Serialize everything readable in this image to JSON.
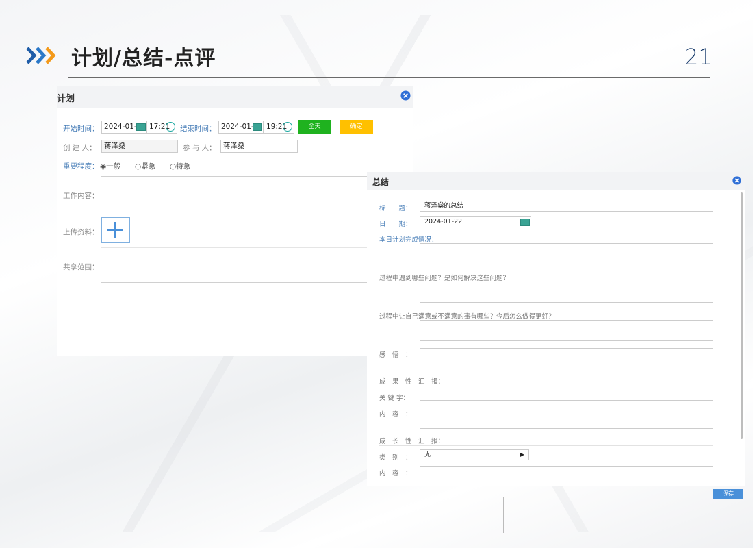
{
  "slide": {
    "title": "计划/总结-点评",
    "page_number": "21"
  },
  "plan": {
    "title": "计划",
    "start_label": "开始时间：",
    "start_date": "2024-01-22",
    "start_time": "17:21",
    "end_label": "结束时间：",
    "end_date": "2024-01-22",
    "end_time": "19:21",
    "allday_button": "全天",
    "confirm_button": "确定",
    "creator_label": "创 建 人：",
    "creator_value": "蒋泽燊",
    "participant_label": "参 与 人：",
    "participant_value": "蒋泽燊",
    "importance_label": "重要程度：",
    "importance_options": [
      "一般",
      "紧急",
      "特急"
    ],
    "importance_selected": "一般",
    "content_label": "工作内容：",
    "upload_label": "上传资料：",
    "share_label": "共享范围："
  },
  "summary": {
    "title": "总结",
    "title_label": "标　　题：",
    "title_value": "蒋泽燊的总结",
    "date_label": "日　　期：",
    "date_value": "2024-01-22",
    "today_label": "本日计划完成情况：",
    "problems_label": "过程中遇到哪些问题？是如何解决这些问题？",
    "satisfaction_label": "过程中让自己满意或不满意的事有哪些？今后怎么做得更好？",
    "insight_label": "感　悟　：",
    "result_section": "成　果　性　汇　报：",
    "keyword_label": "关 键 字：",
    "content_label_1": "内　容　：",
    "growth_section": "成　长　性　汇　报：",
    "category_label": "类　别　：",
    "category_value": "无",
    "content_label_2": "内　容　：",
    "save_button": "保存"
  },
  "colors": {
    "accent_blue": "#4a7fb8",
    "green": "#1fb21f",
    "yellow": "#ffc000",
    "close_blue": "#2f6fd6"
  },
  "icons": [
    "chevrons-icon",
    "close-icon",
    "calendar-icon",
    "clock-icon",
    "plus-icon",
    "radio-icon",
    "caret-right-icon"
  ]
}
